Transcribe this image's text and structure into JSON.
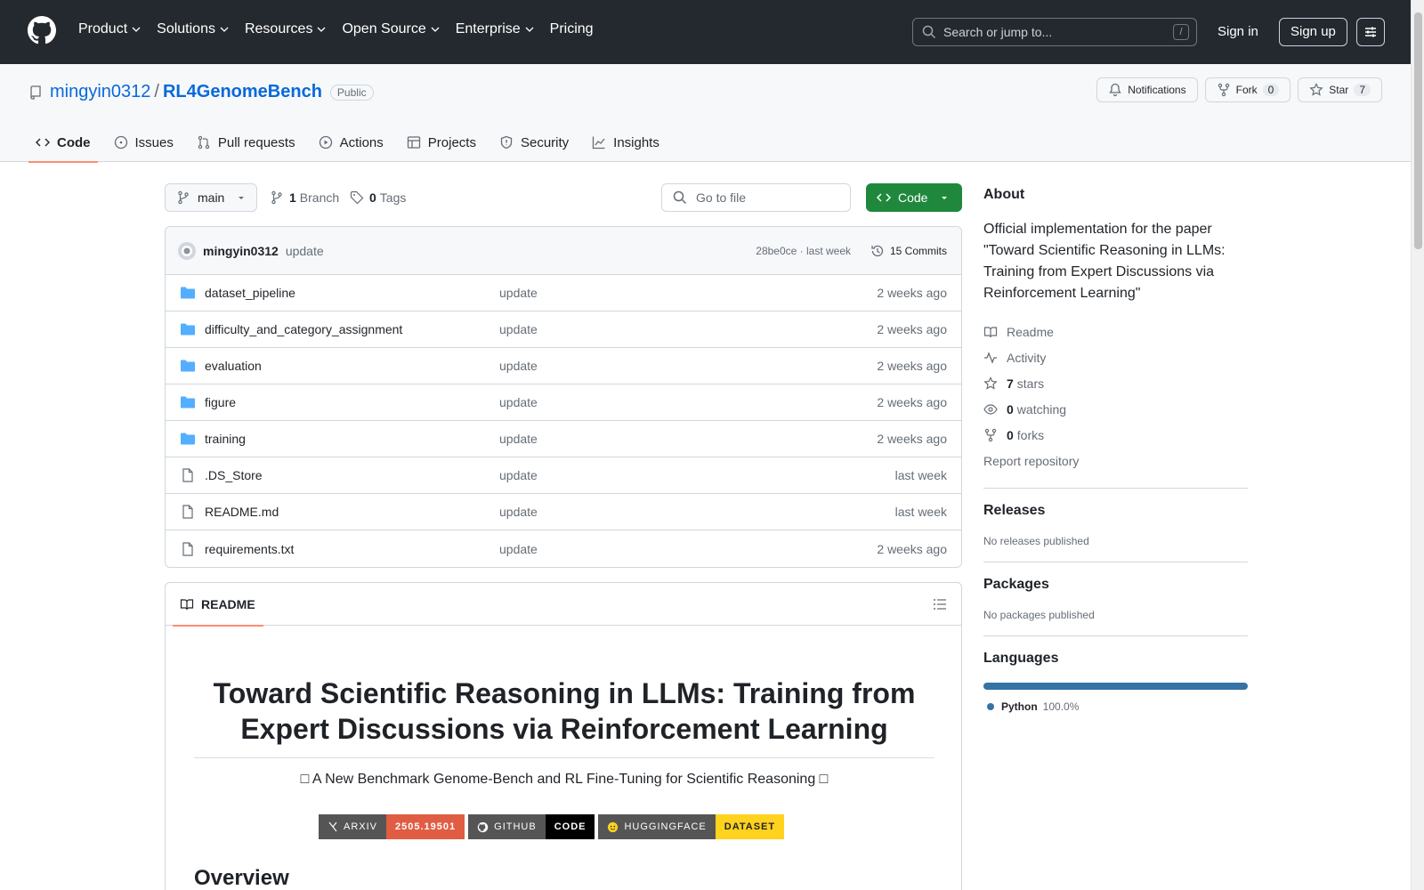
{
  "header": {
    "nav": [
      "Product",
      "Solutions",
      "Resources",
      "Open Source",
      "Enterprise",
      "Pricing"
    ],
    "search_placeholder": "Search or jump to...",
    "search_shortcut": "/",
    "sign_in": "Sign in",
    "sign_up": "Sign up"
  },
  "repo": {
    "owner": "mingyin0312",
    "separator": "/",
    "name": "RL4GenomeBench",
    "visibility": "Public",
    "notifications_label": "Notifications",
    "fork_label": "Fork",
    "fork_count": "0",
    "star_label": "Star",
    "star_count": "7"
  },
  "tabs": [
    "Code",
    "Issues",
    "Pull requests",
    "Actions",
    "Projects",
    "Security",
    "Insights"
  ],
  "branchbar": {
    "branch": "main",
    "branch_count": "1",
    "branch_label": "Branch",
    "tag_count": "0",
    "tag_label": "Tags",
    "goto_placeholder": "Go to file",
    "code_label": "Code"
  },
  "commit": {
    "author": "mingyin0312",
    "message": "update",
    "meta": "28be0ce · last week",
    "commits_label": "15 Commits"
  },
  "files": [
    {
      "name": "dataset_pipeline",
      "type": "dir",
      "message": "update",
      "date": "2 weeks ago"
    },
    {
      "name": "difficulty_and_category_assignment",
      "type": "dir",
      "message": "update",
      "date": "2 weeks ago"
    },
    {
      "name": "evaluation",
      "type": "dir",
      "message": "update",
      "date": "2 weeks ago"
    },
    {
      "name": "figure",
      "type": "dir",
      "message": "update",
      "date": "2 weeks ago"
    },
    {
      "name": "training",
      "type": "dir",
      "message": "update",
      "date": "2 weeks ago"
    },
    {
      "name": ".DS_Store",
      "type": "file",
      "message": "update",
      "date": "last week"
    },
    {
      "name": "README.md",
      "type": "file",
      "message": "update",
      "date": "last week"
    },
    {
      "name": "requirements.txt",
      "type": "file",
      "message": "update",
      "date": "2 weeks ago"
    }
  ],
  "readme": {
    "tab_label": "README",
    "title": "Toward Scientific Reasoning in LLMs: Training from Expert Discussions via Reinforcement Learning",
    "subtitle": "□ A New Benchmark Genome-Bench and RL Fine-Tuning for Scientific Reasoning □",
    "badges": [
      {
        "left": "ARXIV",
        "right": "2505.19501",
        "left_color": "#555555",
        "right_color": "#e05d44",
        "right_text_color": "#ffffff"
      },
      {
        "left": "GITHUB",
        "right": "CODE",
        "left_color": "#555555",
        "right_color": "#000000",
        "right_text_color": "#ffffff"
      },
      {
        "left": "HUGGINGFACE",
        "right": "DATASET",
        "left_color": "#555555",
        "right_color": "#ffd21e",
        "right_text_color": "#1f2328"
      }
    ],
    "overview_heading": "Overview"
  },
  "sidebar": {
    "about_heading": "About",
    "description": "Official implementation for the paper \"Toward Scientific Reasoning in LLMs: Training from Expert Discussions via Reinforcement Learning\"",
    "readme_label": "Readme",
    "activity_label": "Activity",
    "stars_count": "7",
    "stars_label": "stars",
    "watching_count": "0",
    "watching_label": "watching",
    "forks_count": "0",
    "forks_label": "forks",
    "report_label": "Report repository",
    "releases_heading": "Releases",
    "releases_text": "No releases published",
    "packages_heading": "Packages",
    "packages_text": "No packages published",
    "languages_heading": "Languages",
    "language_name": "Python",
    "language_percent": "100.0%"
  },
  "colors": {
    "header_bg": "#24292f",
    "link": "#0969da",
    "code_button": "#1f883d",
    "tab_underline": "#fd8c73",
    "python": "#3572A5",
    "folder": "#54aeff"
  }
}
